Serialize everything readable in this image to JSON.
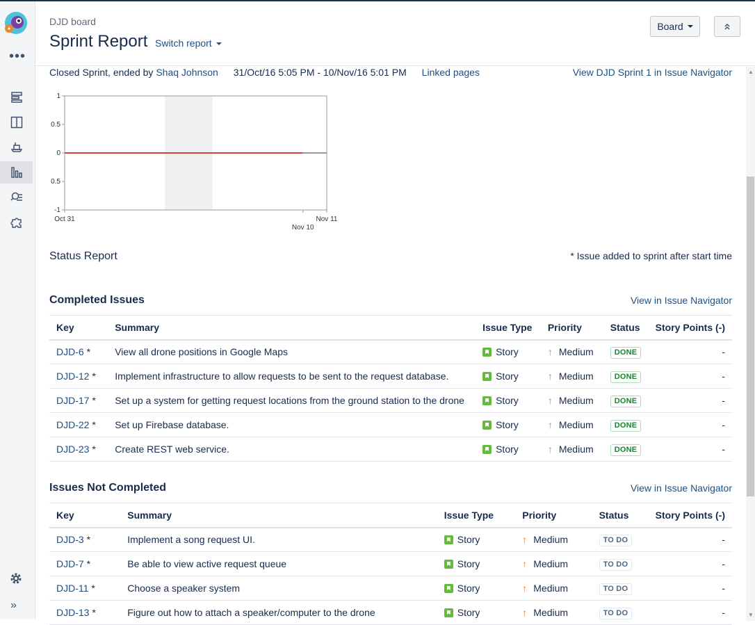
{
  "header": {
    "breadcrumb": "DJD board",
    "title": "Sprint Report",
    "switch_report": "Switch report",
    "board_button": "Board"
  },
  "sprint": {
    "status_prefix": "Closed Sprint, ended by",
    "ended_by": "Shaq Johnson",
    "dates": "31/Oct/16 5:05 PM - 10/Nov/16 5:01 PM",
    "linked_pages": "Linked pages",
    "view_in_navigator": "View DJD Sprint 1 in Issue Navigator"
  },
  "chart_data": {
    "type": "line",
    "y_ticks": [
      "1",
      "0.5",
      "0",
      "0.5",
      "-1"
    ],
    "ylim": [
      -1,
      1
    ],
    "x_ticks": [
      "Oct 31",
      "Nov 10",
      "Nov 11"
    ],
    "grid": false,
    "series": [
      {
        "values": [
          [
            0,
            0
          ],
          [
            10,
            0
          ]
        ],
        "color": "#d04437"
      },
      {
        "values": [
          [
            10,
            0
          ],
          [
            11,
            0
          ]
        ],
        "color": "#999999"
      }
    ],
    "shaded_ranges": [
      [
        4.2,
        6.2
      ]
    ],
    "x_domain": [
      0,
      11
    ]
  },
  "status_report": {
    "title": "Status Report",
    "note": "* Issue added to sprint after start time"
  },
  "completed": {
    "title": "Completed Issues",
    "link": "View in Issue Navigator",
    "columns": [
      "Key",
      "Summary",
      "Issue Type",
      "Priority",
      "Status",
      "Story Points (-)"
    ],
    "rows": [
      {
        "key": "DJD-6",
        "mark": "*",
        "summary": "View all drone positions in Google Maps",
        "type": "Story",
        "priority": "Medium",
        "status": "DONE",
        "points": "-"
      },
      {
        "key": "DJD-12",
        "mark": "*",
        "summary": "Implement infrastructure to allow requests to be sent to the request database.",
        "type": "Story",
        "priority": "Medium",
        "status": "DONE",
        "points": "-"
      },
      {
        "key": "DJD-17",
        "mark": "*",
        "summary": "Set up a system for getting request locations from the ground station to the drone",
        "type": "Story",
        "priority": "Medium",
        "status": "DONE",
        "points": "-"
      },
      {
        "key": "DJD-22",
        "mark": "*",
        "summary": "Set up Firebase database.",
        "type": "Story",
        "priority": "Medium",
        "status": "DONE",
        "points": "-"
      },
      {
        "key": "DJD-23",
        "mark": "*",
        "summary": "Create REST web service.",
        "type": "Story",
        "priority": "Medium",
        "status": "DONE",
        "points": "-"
      }
    ]
  },
  "not_completed": {
    "title": "Issues Not Completed",
    "link": "View in Issue Navigator",
    "columns": [
      "Key",
      "Summary",
      "Issue Type",
      "Priority",
      "Status",
      "Story Points (-)"
    ],
    "rows": [
      {
        "key": "DJD-3",
        "mark": "*",
        "summary": "Implement a song request UI.",
        "type": "Story",
        "priority": "Medium",
        "status": "TO DO",
        "points": "-"
      },
      {
        "key": "DJD-7",
        "mark": "*",
        "summary": "Be able to view active request queue",
        "type": "Story",
        "priority": "Medium",
        "status": "TO DO",
        "points": "-"
      },
      {
        "key": "DJD-11",
        "mark": "*",
        "summary": "Choose a speaker system",
        "type": "Story",
        "priority": "Medium",
        "status": "TO DO",
        "points": "-"
      },
      {
        "key": "DJD-13",
        "mark": "*",
        "summary": "Figure out how to attach a speaker/computer to the drone",
        "type": "Story",
        "priority": "Medium",
        "status": "TO DO",
        "points": "-"
      }
    ]
  },
  "sidebar": {
    "items": [
      {
        "icon": "backlog-icon"
      },
      {
        "icon": "active-sprints-icon"
      },
      {
        "icon": "releases-icon"
      },
      {
        "icon": "reports-icon",
        "active": true
      },
      {
        "icon": "issues-icon"
      },
      {
        "icon": "add-ons-icon"
      }
    ]
  }
}
